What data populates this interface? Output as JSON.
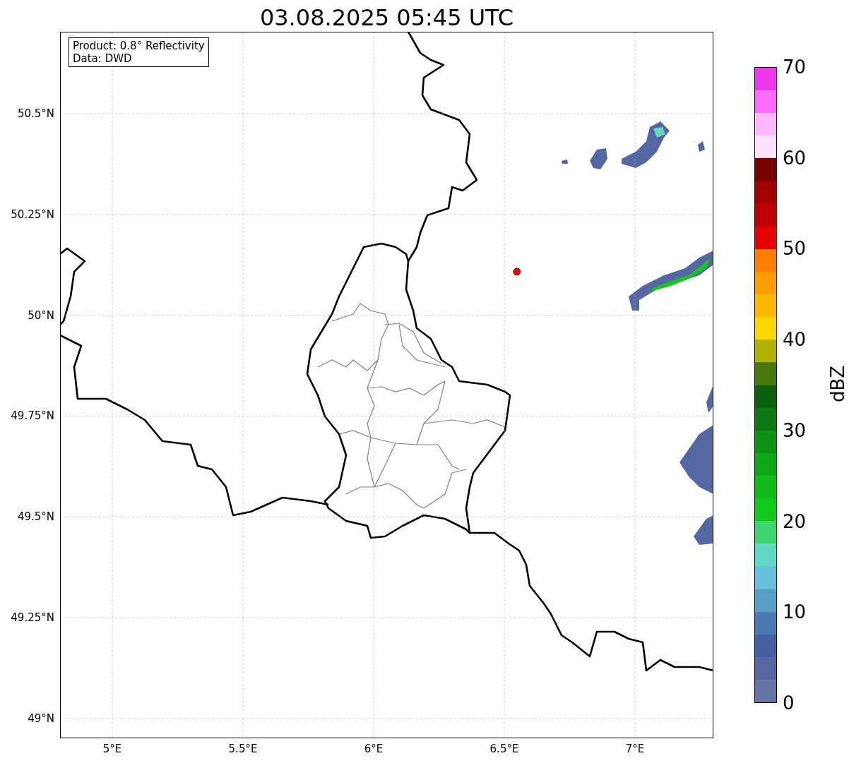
{
  "title": "03.08.2025 05:45 UTC",
  "map": {
    "info_box": {
      "lines": [
        "Product: 0.8° Reflectivity",
        "Data: DWD"
      ]
    },
    "chart_data": {
      "type": "scatter",
      "grid": true,
      "xlim": [
        4.8,
        7.3
      ],
      "ylim": [
        48.951,
        50.703
      ],
      "xticks": [
        {
          "value": 5,
          "label": "5°E"
        },
        {
          "value": 5.5,
          "label": "5.5°E"
        },
        {
          "value": 6,
          "label": "6°E"
        },
        {
          "value": 6.5,
          "label": "6.5°E"
        },
        {
          "value": 7,
          "label": "7°E"
        }
      ],
      "yticks": [
        {
          "value": 50.5,
          "label": "50.5°N"
        },
        {
          "value": 50.25,
          "label": "50.25°N"
        },
        {
          "value": 50,
          "label": "50°N"
        },
        {
          "value": 49.75,
          "label": "49.75°N"
        },
        {
          "value": 49.5,
          "label": "49.5°N"
        },
        {
          "value": 49.25,
          "label": "49.25°N"
        },
        {
          "value": 49,
          "label": "49°N"
        }
      ],
      "x": [
        6.548
      ],
      "series": [
        {
          "color": "#ff0000",
          "values": [
            50.108
          ]
        }
      ]
    }
  },
  "colorbar": {
    "label": "dBZ",
    "ticks": [
      "70",
      "60",
      "50",
      "40",
      "30",
      "20",
      "10",
      "0"
    ],
    "bands": [
      {
        "color": "#ed38ed"
      },
      {
        "color": "#ff6bff"
      },
      {
        "color": "#ffb5ff"
      },
      {
        "color": "#ffe0ff"
      },
      {
        "color": "#7b0000"
      },
      {
        "color": "#a20000"
      },
      {
        "color": "#c00000"
      },
      {
        "color": "#e40000"
      },
      {
        "color": "#ff7e00"
      },
      {
        "color": "#ff9c00"
      },
      {
        "color": "#ffb800"
      },
      {
        "color": "#ffd700"
      },
      {
        "color": "#b0b305"
      },
      {
        "color": "#477a0a"
      },
      {
        "color": "#0a5f0c"
      },
      {
        "color": "#0b7812"
      },
      {
        "color": "#0e9012"
      },
      {
        "color": "#0ea814"
      },
      {
        "color": "#10bb1b"
      },
      {
        "color": "#12c91b"
      },
      {
        "color": "#3dd66e"
      },
      {
        "color": "#63d8c4"
      },
      {
        "color": "#66c2dc"
      },
      {
        "color": "#5a9fc8"
      },
      {
        "color": "#4a7ab4"
      },
      {
        "color": "#4561a3"
      },
      {
        "color": "#5566a0"
      },
      {
        "color": "#6575a6"
      }
    ]
  }
}
